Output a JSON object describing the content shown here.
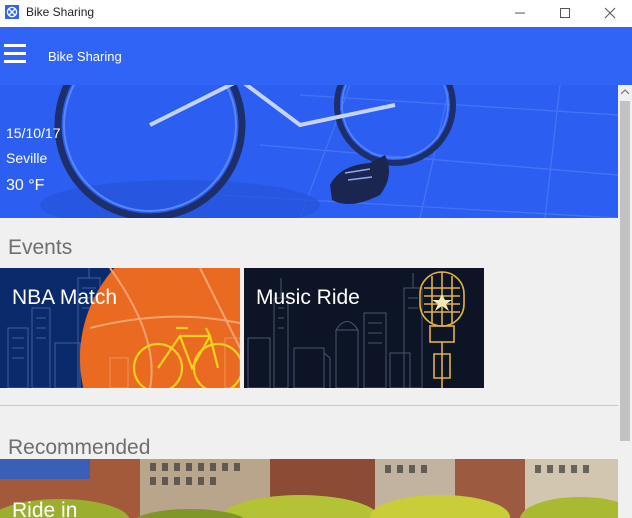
{
  "window": {
    "title": "Bike Sharing",
    "icon": "bike-sharing-app-icon",
    "controls": [
      "minimize-icon",
      "maximize-icon",
      "close-icon"
    ]
  },
  "header": {
    "title": "Bike Sharing",
    "menu_icon": "hamburger-menu-icon",
    "color": "#2f64f7"
  },
  "hero": {
    "date": "15/10/17",
    "city": "Seville",
    "temperature": "30 °F"
  },
  "events": {
    "title": "Events",
    "cards": [
      {
        "label": "NBA Match"
      },
      {
        "label": "Music Ride"
      }
    ]
  },
  "recommended": {
    "title": "Recommended",
    "cards": [
      {
        "label": "Ride in"
      }
    ]
  }
}
